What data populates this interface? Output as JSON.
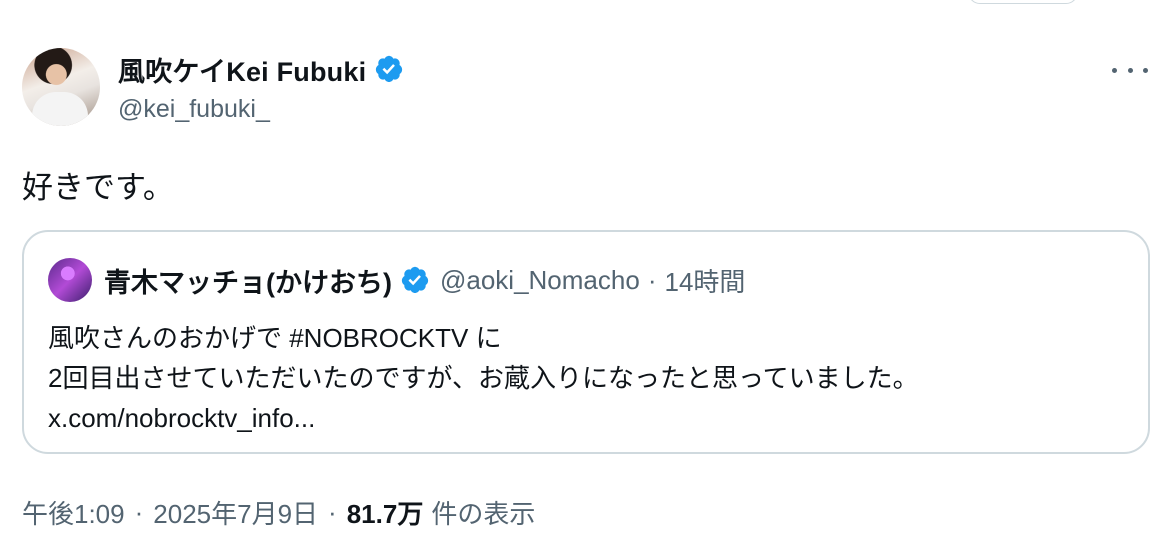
{
  "post": {
    "author": {
      "display_name": "風吹ケイKei Fubuki",
      "handle": "@kei_fubuki_",
      "verified": true
    },
    "text": "好きです。",
    "quoted": {
      "display_name": "青木マッチョ(かけおち)",
      "handle": "@aoki_Nomacho",
      "separator": "·",
      "time": "14時間",
      "verified": true,
      "lines": [
        "風吹さんのおかげで #NOBROCKTV に",
        "2回目出させていただいたのですが、お蔵入りになったと思っていました。",
        "x.com/nobrocktv_info..."
      ]
    },
    "meta": {
      "time": "午後1:09",
      "separator": "·",
      "date": "2025年7月9日",
      "views": "81.7万",
      "views_label": "件の表示"
    }
  },
  "colors": {
    "verified": "#1d9bf0",
    "secondary_text": "#536471",
    "border": "#cfd9de"
  },
  "icons": {
    "verified": "verified-badge-icon",
    "more": "more-horizontal-icon"
  }
}
